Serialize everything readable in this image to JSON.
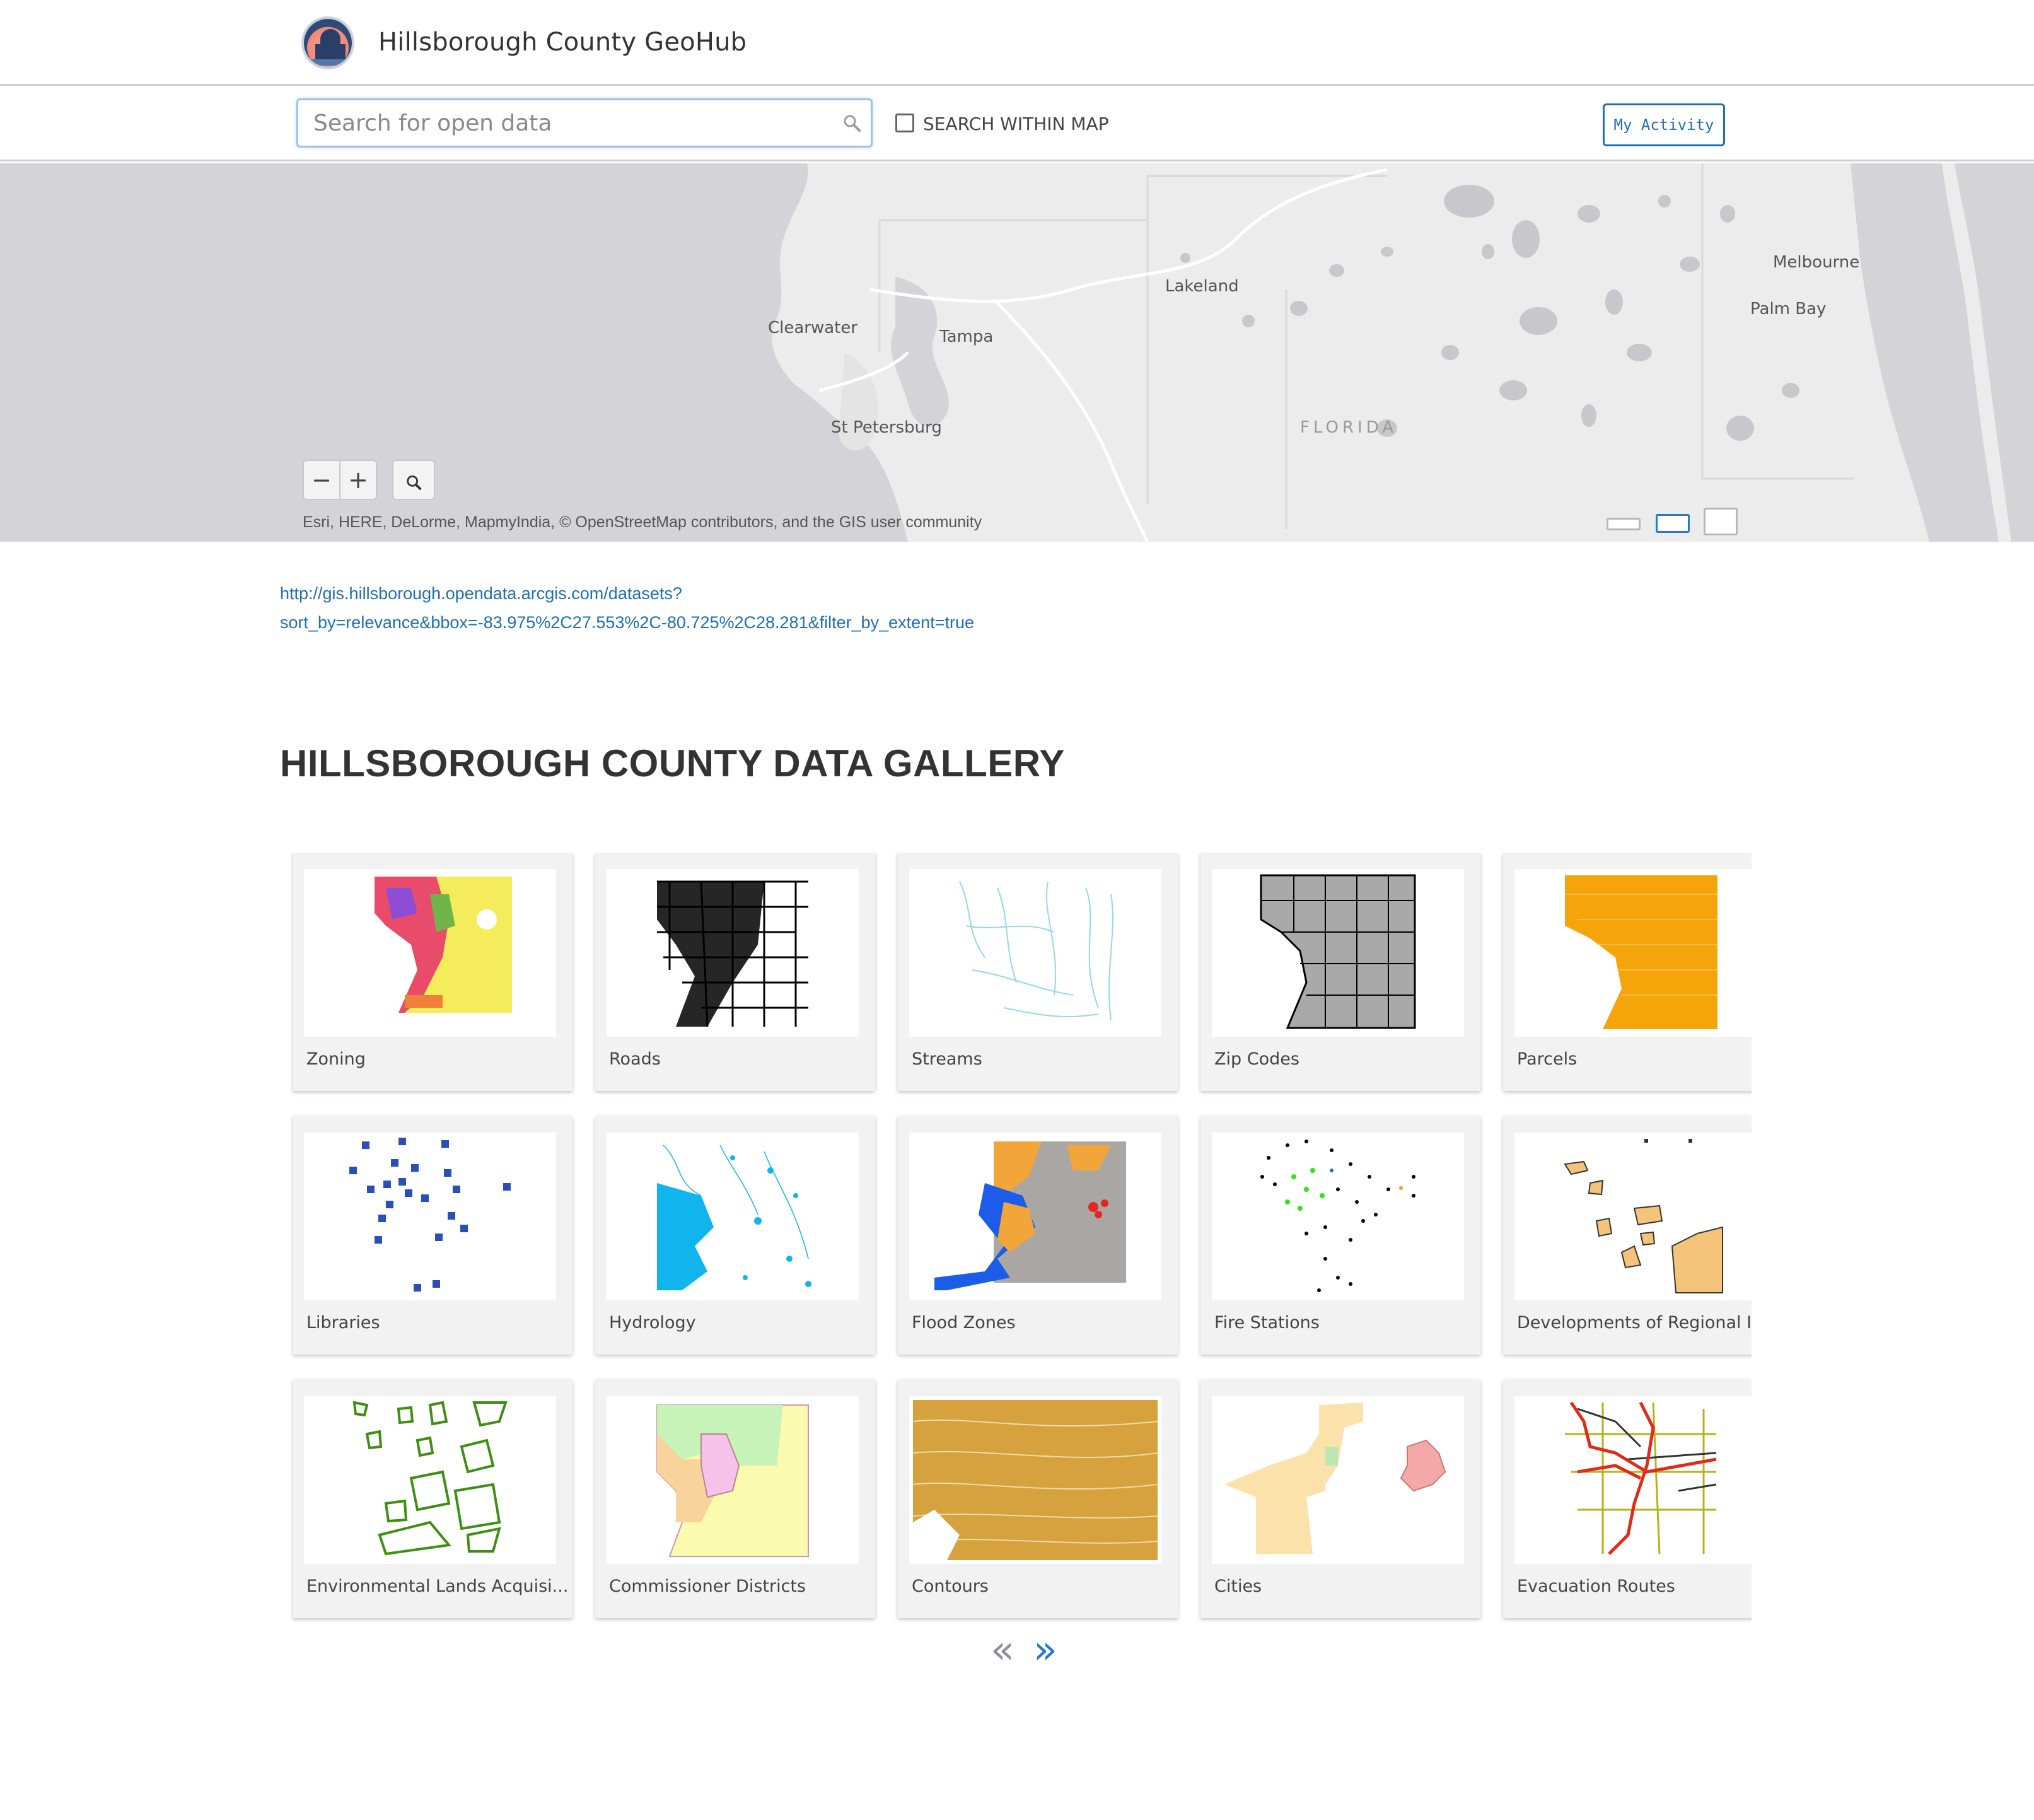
{
  "header": {
    "title": "Hillsborough County GeoHub",
    "logo_icon": "county-courthouse-seal"
  },
  "search": {
    "placeholder": "Search for open data",
    "value": "",
    "within_map_label": "SEARCH WITHIN MAP",
    "within_map_checked": false
  },
  "actions": {
    "my_activity_label": "My Activity"
  },
  "map": {
    "labels": {
      "clearwater": "Clearwater",
      "tampa": "Tampa",
      "st_petersburg": "St Petersburg",
      "lakeland": "Lakeland",
      "florida": "FLORIDA",
      "melbourne": "Melbourne",
      "palm_bay": "Palm Bay"
    },
    "zoom_out": "−",
    "zoom_in": "+",
    "attribution": "Esri, HERE, DeLorme, MapmyIndia, © OpenStreetMap contributors, and the GIS user community"
  },
  "url": {
    "line1": "http://gis.hillsborough.opendata.arcgis.com/datasets?",
    "line2": "sort_by=relevance&bbox=-83.975%2C27.553%2C-80.725%2C28.281&filter_by_extent=true"
  },
  "gallery": {
    "title": "HILLSBOROUGH COUNTY DATA GALLERY",
    "items": [
      {
        "label": "Zoning"
      },
      {
        "label": "Roads"
      },
      {
        "label": "Streams"
      },
      {
        "label": "Zip Codes"
      },
      {
        "label": "Parcels"
      },
      {
        "label": "Libraries"
      },
      {
        "label": "Hydrology"
      },
      {
        "label": "Flood Zones"
      },
      {
        "label": "Fire Stations"
      },
      {
        "label": "Developments of Regional I..."
      },
      {
        "label": "Environmental Lands Acquisi..."
      },
      {
        "label": "Commissioner Districts"
      },
      {
        "label": "Contours"
      },
      {
        "label": "Cities"
      },
      {
        "label": "Evacuation Routes"
      }
    ],
    "prev_label": "«",
    "next_label": "»"
  },
  "colors": {
    "link": "#1f6fb2",
    "pager_prev": "#8a8f99",
    "pager_next": "#2a78c6",
    "map_water": "#d4d4d8",
    "map_land": "#ececec"
  }
}
